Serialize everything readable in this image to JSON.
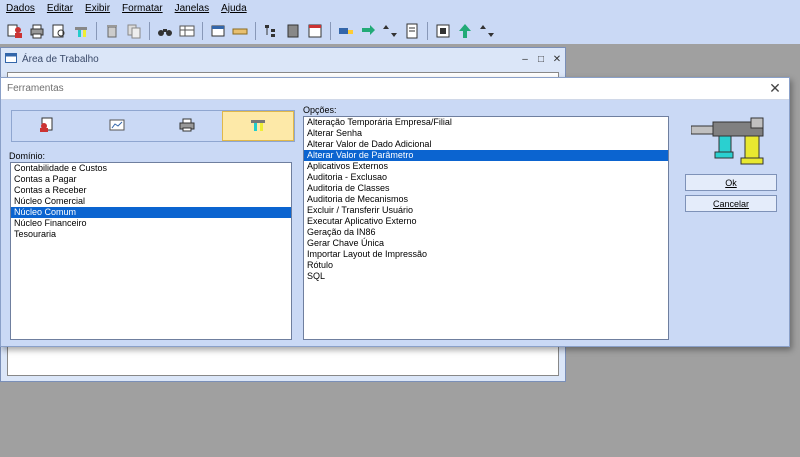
{
  "menubar": {
    "items": [
      {
        "label": "Dados"
      },
      {
        "label": "Editar"
      },
      {
        "label": "Exibir"
      },
      {
        "label": "Formatar"
      },
      {
        "label": "Janelas"
      },
      {
        "label": "Ajuda"
      }
    ]
  },
  "workspace_window": {
    "title": "Área de Trabalho",
    "controls": [
      "–",
      "□",
      "✕"
    ]
  },
  "dialog": {
    "title": "Ferramentas",
    "close_glyph": "✕",
    "domain_label": "Domínio:",
    "options_label": "Opções:",
    "ok_label": "Ok",
    "cancel_label": "Cancelar",
    "domains": [
      "Contabilidade e Custos",
      "Contas a Pagar",
      "Contas a Receber",
      "Núcleo Comercial",
      "Núcleo Comum",
      "Núcleo Financeiro",
      "Tesouraria"
    ],
    "selected_domain": "Núcleo Comum",
    "options": [
      "Alteração Temporária Empresa/Filial",
      "Alterar Senha",
      "Alterar Valor de Dado Adicional",
      "Alterar Valor de Parâmetro",
      "Aplicativos Externos",
      "Auditoria - Exclusao",
      "Auditoria de Classes",
      "Auditoria de Mecanismos",
      "Excluir / Transferir Usuário",
      "Executar Aplicativo Externo",
      "Geração da IN86",
      "Gerar Chave Única",
      "Importar Layout de Impressão",
      "Rótulo",
      "SQL"
    ],
    "selected_option": "Alterar Valor de Parâmetro",
    "active_category": "tools"
  },
  "colors": {
    "selection": "#0b64d0",
    "dialog_bg": "#cad9f5",
    "active_tab": "#fde9a8"
  }
}
